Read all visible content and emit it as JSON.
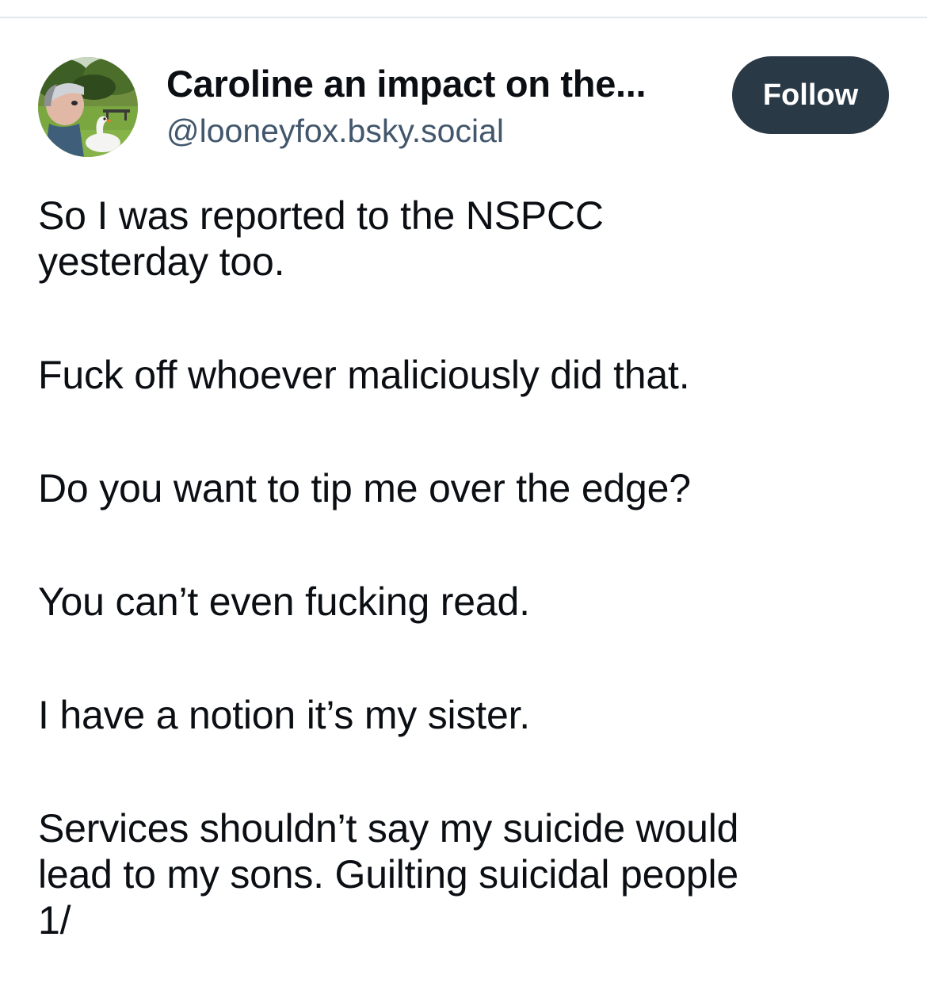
{
  "author": {
    "display_name": "Caroline an impact on the...",
    "handle": "@looneyfox.bsky.social",
    "avatar": "profile-photo"
  },
  "follow_button": {
    "label": "Follow"
  },
  "post": {
    "paragraphs": [
      [
        "So I was reported to the NSPCC",
        "yesterday too."
      ],
      [
        "Fuck off whoever maliciously did that."
      ],
      [
        "Do you want to tip me over the edge?"
      ],
      [
        "You can’t even fucking read."
      ],
      [
        "I have a notion it’s my sister."
      ],
      [
        "Services shouldn’t say my suicide would",
        "lead to my sons.  Guilting suicidal people",
        "1/"
      ]
    ]
  },
  "colors": {
    "follow_button_bg": "#2a3946",
    "handle_text": "#42576c",
    "body_text": "#0b0f14",
    "divider": "#e4e7eb"
  }
}
